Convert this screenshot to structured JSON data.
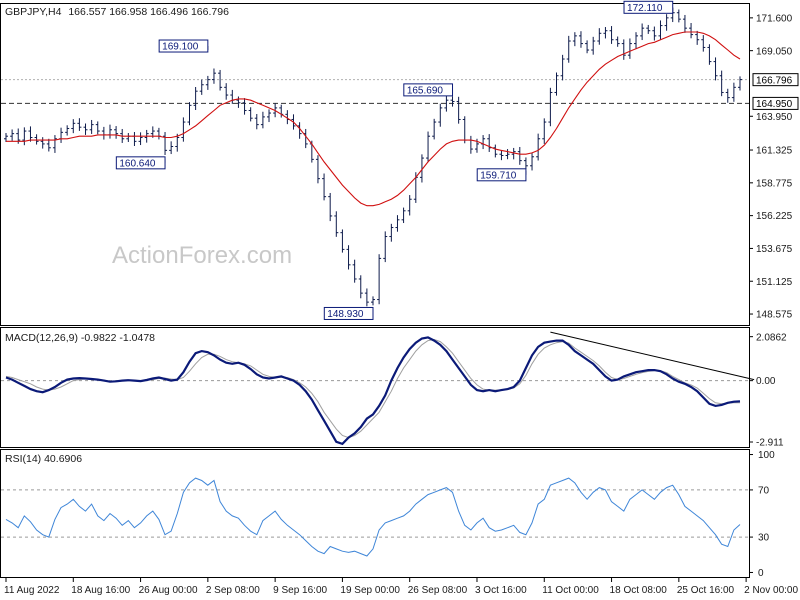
{
  "chart_data": [
    {
      "type": "candlestick",
      "panel": "price",
      "symbol_label": "GBPJPY,H4",
      "ohlc_label": "166.557 166.958 166.496 166.796",
      "watermark": "ActionForex.com",
      "ylim": [
        147.8,
        172.6
      ],
      "y_ticks": [
        "171.600",
        "169.050",
        "166.796",
        "164.950",
        "163.950",
        "161.325",
        "158.775",
        "156.225",
        "153.675",
        "151.125",
        "148.575"
      ],
      "y_tick_values": [
        171.6,
        169.05,
        166.796,
        164.95,
        163.95,
        161.325,
        158.775,
        156.225,
        153.675,
        151.125,
        148.575
      ],
      "highlighted_levels": [
        {
          "label": "166.796",
          "value": 166.796,
          "style": "dotted",
          "color": "#b0b0b0"
        },
        {
          "label": "164.950",
          "value": 164.95,
          "style": "dashed",
          "color": "#333333"
        }
      ],
      "annotations": [
        {
          "label": "169.100",
          "value": 169.1,
          "bar": 33
        },
        {
          "label": "160.640",
          "value": 160.64,
          "bar": 26
        },
        {
          "label": "148.930",
          "value": 148.93,
          "bar": 60
        },
        {
          "label": "165.690",
          "value": 165.69,
          "bar": 73
        },
        {
          "label": "159.710",
          "value": 159.71,
          "bar": 85
        },
        {
          "label": "172.110",
          "value": 172.11,
          "bar": 109
        }
      ],
      "series": [
        {
          "name": "price",
          "closes": [
            162.4,
            162.6,
            162.1,
            162.8,
            162.3,
            162.0,
            161.8,
            161.5,
            162.2,
            162.7,
            163.0,
            163.4,
            163.1,
            162.9,
            163.3,
            162.8,
            162.5,
            162.9,
            162.6,
            162.2,
            162.4,
            162.0,
            162.3,
            162.6,
            162.8,
            162.4,
            161.3,
            161.6,
            162.3,
            163.5,
            164.8,
            165.9,
            166.4,
            166.8,
            167.3,
            166.2,
            165.6,
            165.2,
            165.0,
            164.4,
            163.8,
            163.3,
            163.9,
            164.2,
            164.6,
            164.1,
            163.7,
            163.2,
            162.6,
            161.8,
            160.6,
            159.1,
            157.7,
            156.2,
            154.9,
            153.6,
            152.4,
            151.3,
            150.2,
            149.5,
            149.7,
            152.9,
            154.6,
            155.3,
            155.9,
            156.6,
            157.5,
            159.2,
            160.7,
            162.4,
            163.5,
            164.6,
            165.2,
            165.1,
            163.7,
            162.1,
            161.4,
            161.8,
            162.2,
            161.5,
            161.0,
            160.9,
            161.0,
            161.2,
            160.5,
            160.1,
            160.8,
            162.2,
            163.5,
            165.8,
            167.1,
            168.4,
            169.8,
            170.2,
            169.6,
            169.1,
            169.8,
            170.4,
            170.6,
            169.9,
            169.6,
            168.7,
            169.6,
            170.2,
            170.8,
            170.6,
            170.2,
            171.0,
            171.6,
            172.0,
            171.5,
            170.8,
            170.3,
            169.9,
            169.3,
            168.2,
            167.1,
            165.8,
            165.4,
            166.2,
            166.8
          ]
        },
        {
          "name": "ma",
          "values": [
            162.0,
            162.0,
            162.0,
            162.0,
            162.1,
            162.1,
            162.1,
            162.1,
            162.1,
            162.2,
            162.2,
            162.3,
            162.4,
            162.4,
            162.4,
            162.5,
            162.5,
            162.5,
            162.5,
            162.4,
            162.4,
            162.4,
            162.4,
            162.4,
            162.4,
            162.4,
            162.3,
            162.3,
            162.4,
            162.6,
            162.9,
            163.2,
            163.6,
            164.0,
            164.4,
            164.8,
            165.0,
            165.2,
            165.3,
            165.3,
            165.2,
            165.0,
            164.8,
            164.6,
            164.4,
            164.1,
            163.8,
            163.5,
            163.0,
            162.4,
            161.8,
            161.1,
            160.4,
            159.8,
            159.2,
            158.6,
            158.1,
            157.6,
            157.2,
            157.0,
            157.0,
            157.1,
            157.3,
            157.5,
            157.8,
            158.2,
            158.7,
            159.2,
            159.8,
            160.4,
            160.9,
            161.4,
            161.8,
            162.0,
            162.1,
            162.1,
            162.1,
            162.0,
            161.8,
            161.6,
            161.4,
            161.3,
            161.2,
            161.1,
            161.0,
            161.0,
            161.1,
            161.3,
            161.7,
            162.3,
            163.0,
            163.8,
            164.6,
            165.3,
            166.0,
            166.6,
            167.1,
            167.6,
            168.0,
            168.3,
            168.6,
            168.8,
            169.0,
            169.2,
            169.4,
            169.6,
            169.7,
            169.9,
            170.1,
            170.3,
            170.4,
            170.5,
            170.5,
            170.5,
            170.4,
            170.2,
            169.9,
            169.5,
            169.1,
            168.7,
            168.4
          ]
        }
      ]
    },
    {
      "type": "line",
      "panel": "macd",
      "label": "MACD(12,26,9) -0.9822 -1.0478",
      "ylim": [
        -3.1,
        2.45
      ],
      "y_ticks": [
        "2.0862",
        "0.00",
        "-2.911"
      ],
      "y_tick_values": [
        2.0862,
        0.0,
        -2.911
      ],
      "trendline": {
        "from_bar": 89,
        "from_value": 2.3,
        "to_bar": 121,
        "to_value": 0.05
      },
      "series": [
        {
          "name": "MACD",
          "values": [
            0.15,
            0.05,
            -0.1,
            -0.25,
            -0.4,
            -0.5,
            -0.55,
            -0.45,
            -0.3,
            -0.1,
            0.05,
            0.1,
            0.12,
            0.1,
            0.08,
            0.05,
            0.0,
            -0.05,
            -0.03,
            0.0,
            0.02,
            0.0,
            -0.02,
            0.03,
            0.1,
            0.15,
            0.08,
            0.0,
            0.05,
            0.4,
            0.9,
            1.3,
            1.4,
            1.35,
            1.2,
            1.0,
            0.85,
            0.8,
            0.85,
            0.75,
            0.55,
            0.3,
            0.15,
            0.1,
            0.15,
            0.2,
            0.1,
            0.0,
            -0.2,
            -0.5,
            -0.9,
            -1.4,
            -1.9,
            -2.4,
            -2.9,
            -3.0,
            -2.7,
            -2.5,
            -2.2,
            -1.8,
            -1.6,
            -1.2,
            -0.7,
            0.0,
            0.6,
            1.1,
            1.5,
            1.8,
            2.0,
            2.05,
            1.9,
            1.7,
            1.4,
            1.0,
            0.6,
            0.2,
            -0.2,
            -0.45,
            -0.5,
            -0.45,
            -0.5,
            -0.45,
            -0.4,
            -0.3,
            0.0,
            0.6,
            1.2,
            1.6,
            1.8,
            1.85,
            1.9,
            1.9,
            1.7,
            1.4,
            1.2,
            1.0,
            0.8,
            0.5,
            0.2,
            0.0,
            0.05,
            0.2,
            0.3,
            0.4,
            0.45,
            0.5,
            0.5,
            0.45,
            0.3,
            0.1,
            -0.05,
            -0.15,
            -0.3,
            -0.5,
            -0.8,
            -1.1,
            -1.2,
            -1.15,
            -1.05,
            -1.0,
            -0.98
          ]
        },
        {
          "name": "Signal",
          "values": [
            0.2,
            0.15,
            0.05,
            -0.05,
            -0.15,
            -0.3,
            -0.4,
            -0.45,
            -0.4,
            -0.3,
            -0.15,
            0.0,
            0.05,
            0.08,
            0.08,
            0.06,
            0.02,
            -0.02,
            -0.03,
            -0.01,
            0.01,
            0.01,
            0.0,
            0.01,
            0.05,
            0.1,
            0.12,
            0.08,
            0.05,
            0.15,
            0.45,
            0.8,
            1.1,
            1.25,
            1.25,
            1.15,
            1.0,
            0.9,
            0.85,
            0.8,
            0.7,
            0.5,
            0.3,
            0.2,
            0.15,
            0.17,
            0.15,
            0.05,
            -0.1,
            -0.3,
            -0.6,
            -1.0,
            -1.5,
            -1.9,
            -2.3,
            -2.6,
            -2.7,
            -2.6,
            -2.4,
            -2.1,
            -1.8,
            -1.5,
            -1.0,
            -0.5,
            0.1,
            0.6,
            1.0,
            1.4,
            1.7,
            1.9,
            1.95,
            1.85,
            1.6,
            1.3,
            0.9,
            0.5,
            0.1,
            -0.2,
            -0.4,
            -0.45,
            -0.45,
            -0.45,
            -0.42,
            -0.35,
            -0.15,
            0.25,
            0.8,
            1.25,
            1.55,
            1.7,
            1.8,
            1.85,
            1.78,
            1.55,
            1.35,
            1.15,
            0.95,
            0.7,
            0.4,
            0.15,
            0.05,
            0.1,
            0.2,
            0.3,
            0.38,
            0.44,
            0.48,
            0.47,
            0.38,
            0.2,
            0.05,
            -0.1,
            -0.2,
            -0.35,
            -0.6,
            -0.85,
            -1.05,
            -1.1,
            -1.07,
            -1.05,
            -1.05
          ]
        }
      ]
    },
    {
      "type": "line",
      "panel": "rsi",
      "label": "RSI(14) 40.6906",
      "ylim": [
        -3,
        103
      ],
      "y_ticks": [
        "100",
        "70",
        "30",
        "0"
      ],
      "y_tick_values": [
        100,
        70,
        30,
        0
      ],
      "levels": [
        70,
        30
      ],
      "series": [
        {
          "name": "RSI",
          "values": [
            45,
            42,
            38,
            48,
            43,
            36,
            32,
            30,
            45,
            55,
            58,
            62,
            56,
            52,
            58,
            48,
            44,
            50,
            46,
            40,
            44,
            38,
            42,
            48,
            52,
            45,
            32,
            35,
            50,
            68,
            76,
            80,
            78,
            74,
            78,
            60,
            52,
            48,
            46,
            40,
            35,
            32,
            44,
            48,
            52,
            45,
            40,
            36,
            32,
            27,
            22,
            18,
            16,
            22,
            20,
            18,
            17,
            18,
            16,
            14,
            20,
            36,
            42,
            44,
            46,
            48,
            52,
            58,
            62,
            66,
            68,
            70,
            72,
            68,
            52,
            40,
            36,
            42,
            46,
            38,
            35,
            36,
            38,
            40,
            34,
            32,
            42,
            58,
            62,
            74,
            76,
            78,
            80,
            76,
            68,
            62,
            68,
            72,
            70,
            60,
            56,
            52,
            62,
            66,
            70,
            66,
            62,
            68,
            72,
            74,
            66,
            56,
            52,
            48,
            44,
            38,
            32,
            24,
            22,
            36,
            40.7
          ]
        }
      ]
    }
  ],
  "x_axis": {
    "labels": [
      "11 Aug 2022",
      "18 Aug 16:00",
      "26 Aug 00:00",
      "2 Sep 08:00",
      "9 Sep 16:00",
      "19 Sep 00:00",
      "26 Sep 08:00",
      "3 Oct 16:00",
      "11 Oct 00:00",
      "18 Oct 08:00",
      "25 Oct 16:00",
      "2 Nov 00:00"
    ],
    "label_bars": [
      0,
      11,
      22,
      33,
      44,
      55,
      66,
      77,
      88,
      99,
      110,
      121
    ]
  },
  "colors": {
    "candle": "#0d1a4a",
    "ma": "#d01010",
    "macd": "#0b1a78",
    "signal": "#a0a0a0",
    "rsi": "#3f86d8",
    "grid_level": "#9a9a9a",
    "text": "#1a1a1a",
    "watermark": "#c8c8c8",
    "box_border": "#0b1a78"
  }
}
